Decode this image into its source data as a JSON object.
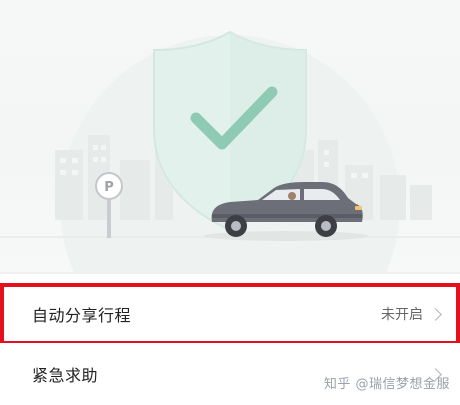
{
  "menu": {
    "auto_share_trip": {
      "label": "自动分享行程",
      "status": "未开启"
    },
    "emergency_help": {
      "label": "紧急求助"
    }
  },
  "watermark": {
    "text": "知乎 @瑞信梦想金服"
  },
  "colors": {
    "highlight_border": "#e5101d",
    "shield_tint": "#e2f1ec",
    "check_mark": "#8fcab5",
    "car_body": "#6d6f78"
  },
  "icons": {
    "shield": "shield-check-icon",
    "parking": "parking-sign-icon",
    "chevron": "chevron-right-icon"
  }
}
